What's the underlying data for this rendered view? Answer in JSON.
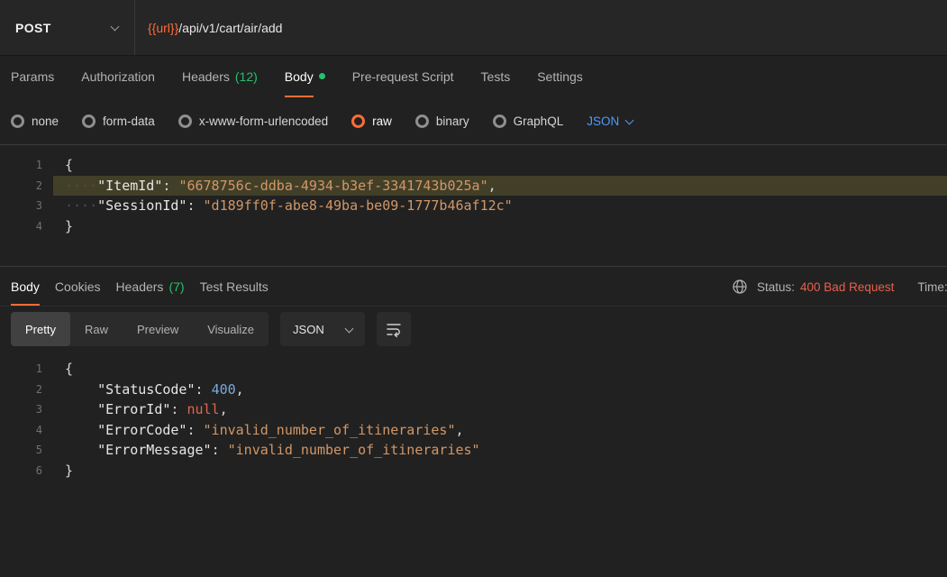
{
  "request_bar": {
    "method": "POST",
    "url_variable": "{{url}}",
    "url_path": "/api/v1/cart/air/add"
  },
  "request_tabs": {
    "params": "Params",
    "authorization": "Authorization",
    "headers": "Headers",
    "headers_count": "(12)",
    "body": "Body",
    "pre_request_script": "Pre-request Script",
    "tests": "Tests",
    "settings": "Settings"
  },
  "body_type": {
    "options": {
      "none": "none",
      "form_data": "form-data",
      "urlencoded": "x-www-form-urlencoded",
      "raw": "raw",
      "binary": "binary",
      "graphql": "GraphQL"
    },
    "selected": "raw",
    "language": "JSON"
  },
  "request_editor": {
    "lines": [
      {
        "num": "1",
        "tokens": [
          {
            "t": "{",
            "c": "punct"
          }
        ]
      },
      {
        "num": "2",
        "highlight": true,
        "tokens": [
          {
            "t": "····",
            "c": "ws"
          },
          {
            "t": "\"ItemId\"",
            "c": "key"
          },
          {
            "t": ": ",
            "c": "punct"
          },
          {
            "t": "\"6678756c-ddba-4934-b3ef-3341743b025a\"",
            "c": "str"
          },
          {
            "t": ",",
            "c": "punct"
          }
        ]
      },
      {
        "num": "3",
        "tokens": [
          {
            "t": "····",
            "c": "ws"
          },
          {
            "t": "\"SessionId\"",
            "c": "key"
          },
          {
            "t": ": ",
            "c": "punct"
          },
          {
            "t": "\"d189ff0f-abe8-49ba-be09-1777b46af12c\"",
            "c": "str"
          }
        ]
      },
      {
        "num": "4",
        "tokens": [
          {
            "t": "}",
            "c": "punct"
          }
        ]
      }
    ]
  },
  "response_tabs": {
    "body": "Body",
    "cookies": "Cookies",
    "headers": "Headers",
    "headers_count": "(7)",
    "test_results": "Test Results"
  },
  "response_meta": {
    "status_label": "Status:",
    "status_value": "400 Bad Request",
    "time_label": "Time:"
  },
  "response_toolbar": {
    "pretty": "Pretty",
    "raw": "Raw",
    "preview": "Preview",
    "visualize": "Visualize",
    "language": "JSON"
  },
  "response_editor": {
    "lines": [
      {
        "num": "1",
        "tokens": [
          {
            "t": "{",
            "c": "punct"
          }
        ]
      },
      {
        "num": "2",
        "tokens": [
          {
            "t": "    ",
            "c": "plain"
          },
          {
            "t": "\"StatusCode\"",
            "c": "key"
          },
          {
            "t": ": ",
            "c": "punct"
          },
          {
            "t": "400",
            "c": "num"
          },
          {
            "t": ",",
            "c": "punct"
          }
        ]
      },
      {
        "num": "3",
        "tokens": [
          {
            "t": "    ",
            "c": "plain"
          },
          {
            "t": "\"ErrorId\"",
            "c": "key"
          },
          {
            "t": ": ",
            "c": "punct"
          },
          {
            "t": "null",
            "c": "null"
          },
          {
            "t": ",",
            "c": "punct"
          }
        ]
      },
      {
        "num": "4",
        "tokens": [
          {
            "t": "    ",
            "c": "plain"
          },
          {
            "t": "\"ErrorCode\"",
            "c": "key"
          },
          {
            "t": ": ",
            "c": "punct"
          },
          {
            "t": "\"invalid_number_of_itineraries\"",
            "c": "str"
          },
          {
            "t": ",",
            "c": "punct"
          }
        ]
      },
      {
        "num": "5",
        "tokens": [
          {
            "t": "    ",
            "c": "plain"
          },
          {
            "t": "\"ErrorMessage\"",
            "c": "key"
          },
          {
            "t": ": ",
            "c": "punct"
          },
          {
            "t": "\"invalid_number_of_itineraries\"",
            "c": "str"
          }
        ]
      },
      {
        "num": "6",
        "tokens": [
          {
            "t": "}",
            "c": "punct"
          }
        ]
      }
    ]
  },
  "colors": {
    "accent_orange": "#ff6c37",
    "green": "#27c06d",
    "link_blue": "#4c9aff",
    "status_error": "#e8604a",
    "json_string": "#d29766",
    "json_number": "#7ca9dd",
    "json_null": "#e0674e"
  }
}
